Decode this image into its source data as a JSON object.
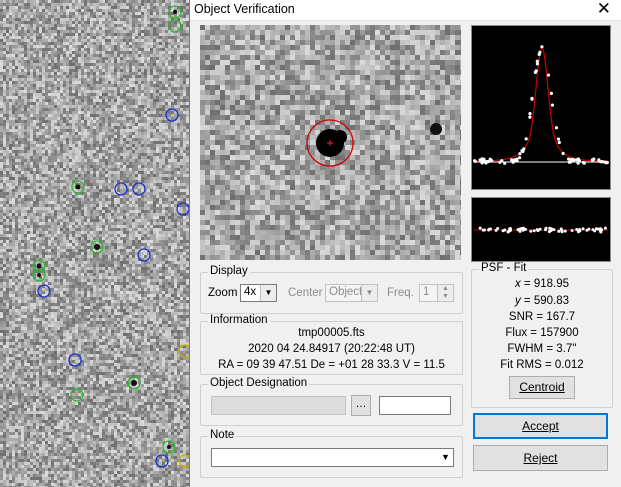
{
  "window": {
    "title": "Object Verification",
    "close_glyph": "✕"
  },
  "display": {
    "group_label": "Display",
    "zoom_label": "Zoom",
    "zoom_value": "4x",
    "center_label": "Center",
    "center_value": "Object",
    "freq_label": "Freq.",
    "freq_value": "1"
  },
  "information": {
    "group_label": "Information",
    "filename": "tmp00005.fts",
    "datetime": "2020 04 24.84917 (20:22:48 UT)",
    "coords": "RA = 09 39 47.51   De = +01 28 33.3   V = 11.5"
  },
  "designation": {
    "group_label": "Object Designation",
    "browse_glyph": "…"
  },
  "note": {
    "group_label": "Note"
  },
  "psf": {
    "group_label": "PSF - Fit",
    "x_label": "x",
    "x_value": "= 918.95",
    "y_label": "y",
    "y_value": "= 590.83",
    "snr": "SNR = 167.7",
    "flux": "Flux = 157900",
    "fwhm": "FWHM = 3.7''",
    "fit_rms": "Fit RMS = 0.012",
    "centroid_button": "Centroid"
  },
  "buttons": {
    "accept": "Accept",
    "reject": "Reject"
  },
  "colors": {
    "fit_curve": "#cc0000",
    "marker_ring": "#d40000",
    "known_ring": "#2ab82a",
    "unknown_ring": "#2030d0"
  }
}
